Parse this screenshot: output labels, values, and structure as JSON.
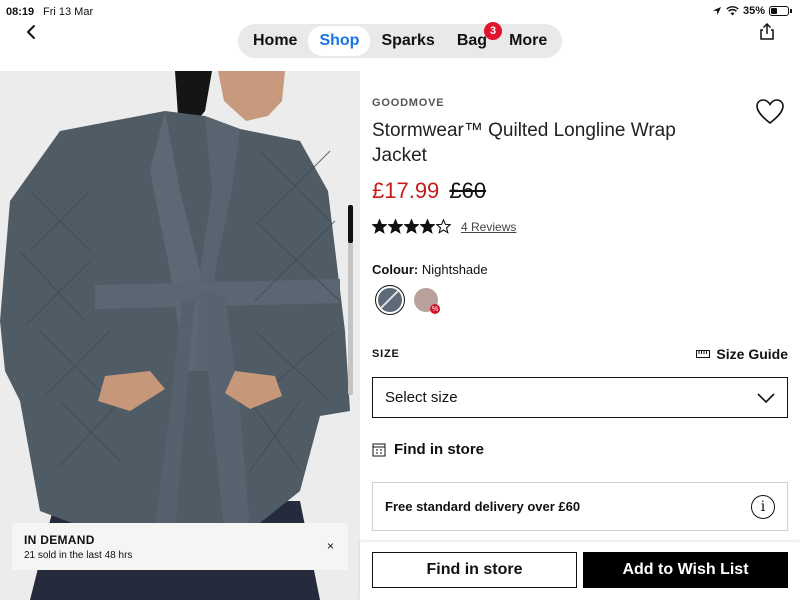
{
  "status_bar": {
    "time": "08:19",
    "date": "Fri 13 Mar",
    "battery": "35%"
  },
  "nav": {
    "tabs": [
      {
        "label": "Home"
      },
      {
        "label": "Shop",
        "active": true
      },
      {
        "label": "Sparks"
      },
      {
        "label": "Bag",
        "badge": "3"
      },
      {
        "label": "More"
      }
    ]
  },
  "colors": {
    "active_tab": "#1a73e8",
    "sale_price": "#c51c1c",
    "badge": "#e0142c",
    "jacket": "#4f5b65"
  },
  "demand_banner": {
    "title": "IN DEMAND",
    "subtitle": "21 sold in the last 48 hrs",
    "close": "×"
  },
  "product": {
    "brand": "GOODMOVE",
    "title": "Stormwear™ Quilted Longline Wrap Jacket",
    "price_now": "£17.99",
    "price_was": "£60",
    "rating": 4,
    "rating_max": 5,
    "reviews_label": "4 Reviews",
    "colour_label": "Colour:",
    "colour_value": "Nightshade",
    "size_label": "SIZE",
    "size_guide_label": "Size Guide",
    "size_select_placeholder": "Select size",
    "find_in_store_label": "Find in store",
    "delivery_text": "Free standard delivery over £60"
  },
  "actions": {
    "find_in_store": "Find in store",
    "add_to_wish_list": "Add to Wish List"
  },
  "icons": [
    "back-chevron-icon",
    "share-icon",
    "heart-icon",
    "star-icon",
    "ruler-icon",
    "store-icon",
    "info-icon",
    "chevron-down-icon",
    "close-icon"
  ]
}
